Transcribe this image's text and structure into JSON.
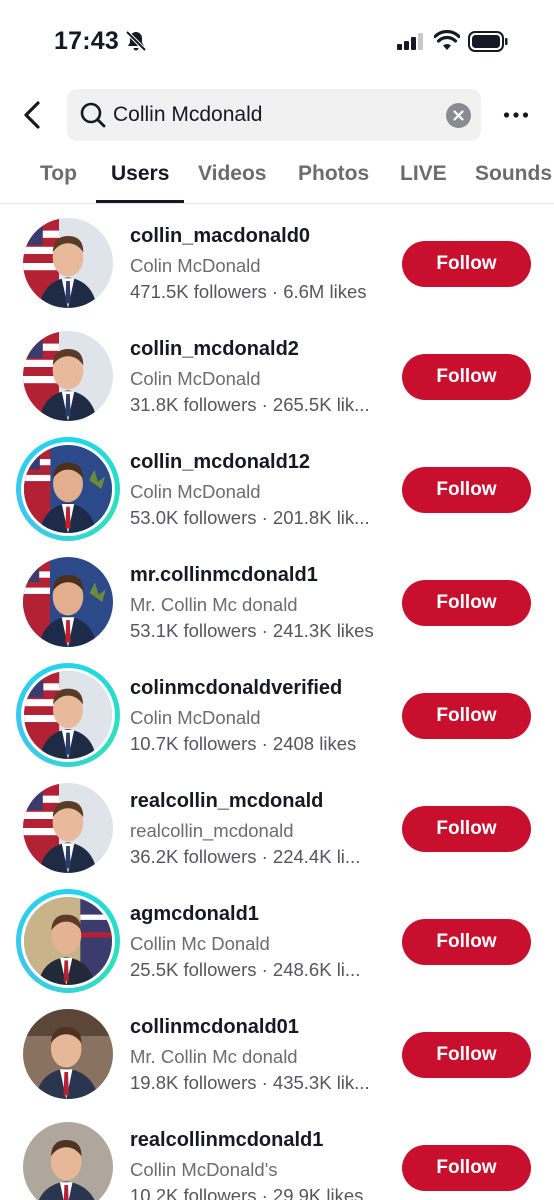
{
  "status_bar": {
    "time": "17:43"
  },
  "search": {
    "query": "Collin Mcdonald"
  },
  "tabs": [
    {
      "label": "Top"
    },
    {
      "label": "Users"
    },
    {
      "label": "Videos"
    },
    {
      "label": "Photos"
    },
    {
      "label": "LIVE"
    },
    {
      "label": "Sounds"
    }
  ],
  "active_tab": "Users",
  "colors": {
    "follow_button": "#c8102e",
    "story_ring": "#20d5ec"
  },
  "users": [
    {
      "username": "collin_macdonald0",
      "display_name": "Colin McDonald",
      "stats": "471.5K followers · 6.6M likes",
      "follow_label": "Follow",
      "story_ring": false,
      "avatar": "flag-portrait-avatar"
    },
    {
      "username": "collin_mcdonald2",
      "display_name": "Colin McDonald",
      "stats": "31.8K followers · 265.5K lik...",
      "follow_label": "Follow",
      "story_ring": false,
      "avatar": "flag-portrait-avatar"
    },
    {
      "username": "collin_mcdonald12",
      "display_name": "Colin McDonald",
      "stats": "53.0K followers · 201.8K lik...",
      "follow_label": "Follow",
      "story_ring": true,
      "avatar": "state-flag-portrait-avatar"
    },
    {
      "username": "mr.collinmcdonald1",
      "display_name": "Mr. Collin Mc donald",
      "stats": "53.1K followers · 241.3K likes",
      "follow_label": "Follow",
      "story_ring": false,
      "avatar": "state-flag-portrait-avatar"
    },
    {
      "username": "colinmcdonaldverified",
      "display_name": "Colin McDonald",
      "stats": "10.7K followers · 2408 likes",
      "follow_label": "Follow",
      "story_ring": true,
      "avatar": "flag-portrait-avatar"
    },
    {
      "username": "realcollin_mcdonald",
      "display_name": "realcollin_mcdonald",
      "stats": "36.2K followers · 224.4K li...",
      "follow_label": "Follow",
      "story_ring": false,
      "avatar": "flag-portrait-avatar"
    },
    {
      "username": "agmcdonald1",
      "display_name": "Collin Mc Donald",
      "stats": "25.5K followers · 248.6K li...",
      "follow_label": "Follow",
      "story_ring": true,
      "avatar": "office-portrait-avatar"
    },
    {
      "username": "collinmcdonald01",
      "display_name": "Mr. Collin Mc donald",
      "stats": "19.8K followers · 435.3K lik...",
      "follow_label": "Follow",
      "story_ring": false,
      "avatar": "hearing-portrait-avatar"
    },
    {
      "username": "realcollinmcdonald1",
      "display_name": "Collin McDonald's",
      "stats": "10.2K followers · 29.9K likes",
      "follow_label": "Follow",
      "story_ring": false,
      "avatar": "hearing-portrait-avatar"
    }
  ]
}
